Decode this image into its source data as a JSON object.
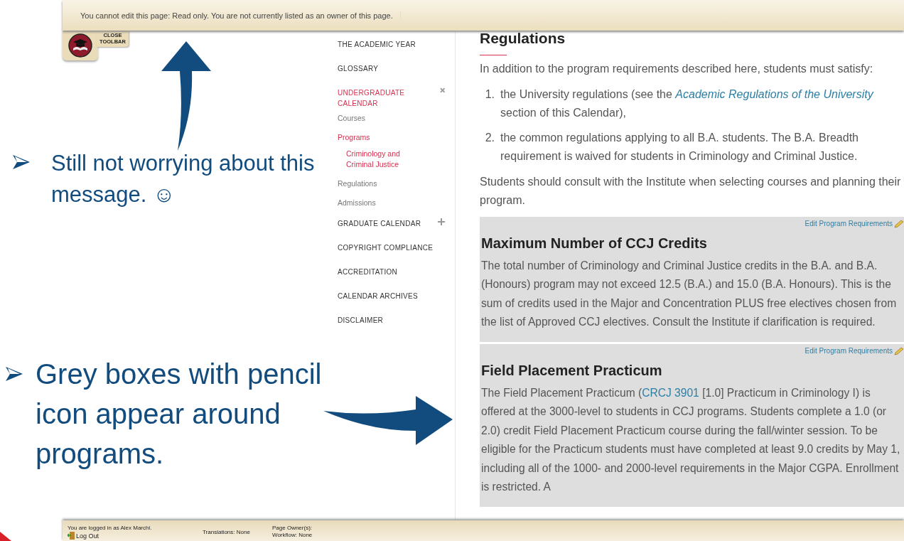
{
  "toolbar": {
    "message": "You cannot edit this page: Read only. You are not currently listed as an owner of this page.",
    "close_label": "CLOSE TOOLBAR"
  },
  "nav": {
    "items": [
      {
        "label": "THE ACADEMIC YEAR",
        "selected": false
      },
      {
        "label": "GLOSSARY",
        "selected": false
      },
      {
        "label": "UNDERGRADUATE CALENDAR",
        "selected": true,
        "expanded": true,
        "children": [
          {
            "label": "Courses",
            "selected": false
          },
          {
            "label": "Programs",
            "selected": true,
            "children": [
              {
                "label": "Criminology and Criminal Justice",
                "selected": true
              }
            ]
          },
          {
            "label": "Regulations",
            "selected": false
          },
          {
            "label": "Admissions",
            "selected": false
          }
        ]
      },
      {
        "label": "GRADUATE CALENDAR",
        "selected": false,
        "expanded": false
      },
      {
        "label": "COPYRIGHT COMPLIANCE",
        "selected": false
      },
      {
        "label": "ACCREDITATION",
        "selected": false
      },
      {
        "label": "CALENDAR ARCHIVES",
        "selected": false
      },
      {
        "label": "DISCLAIMER",
        "selected": false
      }
    ]
  },
  "content": {
    "title": "Regulations",
    "intro": "In addition to the program requirements described here, students must satisfy:",
    "list": [
      {
        "number": "1.",
        "segments": [
          {
            "kind": "text",
            "text": "the University regulations (see the "
          },
          {
            "kind": "link",
            "text": "Academic Regulations of the University"
          },
          {
            "kind": "text",
            "text": " section of this Calendar),"
          }
        ]
      },
      {
        "number": "2.",
        "segments": [
          {
            "kind": "text",
            "text": "the common regulations applying to all B.A. students. The B.A. Breadth requirement is waived for students in Criminology and Criminal Justice."
          }
        ]
      }
    ],
    "note": "Students should consult with the Institute when selecting courses and planning their program.",
    "sections": [
      {
        "edit_label": "Edit Program Requirements",
        "title": "Maximum Number of CCJ Credits",
        "segments": [
          {
            "kind": "text",
            "text": "The total number of Criminology and Criminal Justice credits in the B.A. and B.A. (Honours) program may not exceed 12.5 (B.A.) and 15.0 (B.A. Honours). This is the sum of credits used in the Major and Concentration PLUS free electives chosen from the list of Approved CCJ electives. Consult the Institute if clarification is required."
          }
        ]
      },
      {
        "edit_label": "Edit Program Requirements",
        "title": "Field Placement Practicum",
        "segments": [
          {
            "kind": "text",
            "text": "The Field Placement Practicum ("
          },
          {
            "kind": "link",
            "text": "CRCJ 3901"
          },
          {
            "kind": "text",
            "text": " [1.0] Practicum in Criminology I) is offered at the 3000-level to students in CCJ programs. Students complete a 1.0 (or 2.0) credit Field Placement Practicum course during the fall/winter session. To be eligible for the Practicum students must have completed at least 9.0 credits by May 1, including all of the 1000- and 2000-level requirements in the Major CGPA. Enrollment is restricted. A"
          }
        ]
      }
    ]
  },
  "footer": {
    "login": "You are logged in as Alex Marchi.",
    "logout": "Log Out",
    "translations": "Translations: None",
    "owners": "Page Owner(s):",
    "workflow": "Workflow: None"
  },
  "slide": {
    "callouts": [
      {
        "text": "Still not worrying about this message. ☺"
      },
      {
        "text": "Grey boxes with pencil icon appear around programs."
      }
    ]
  }
}
